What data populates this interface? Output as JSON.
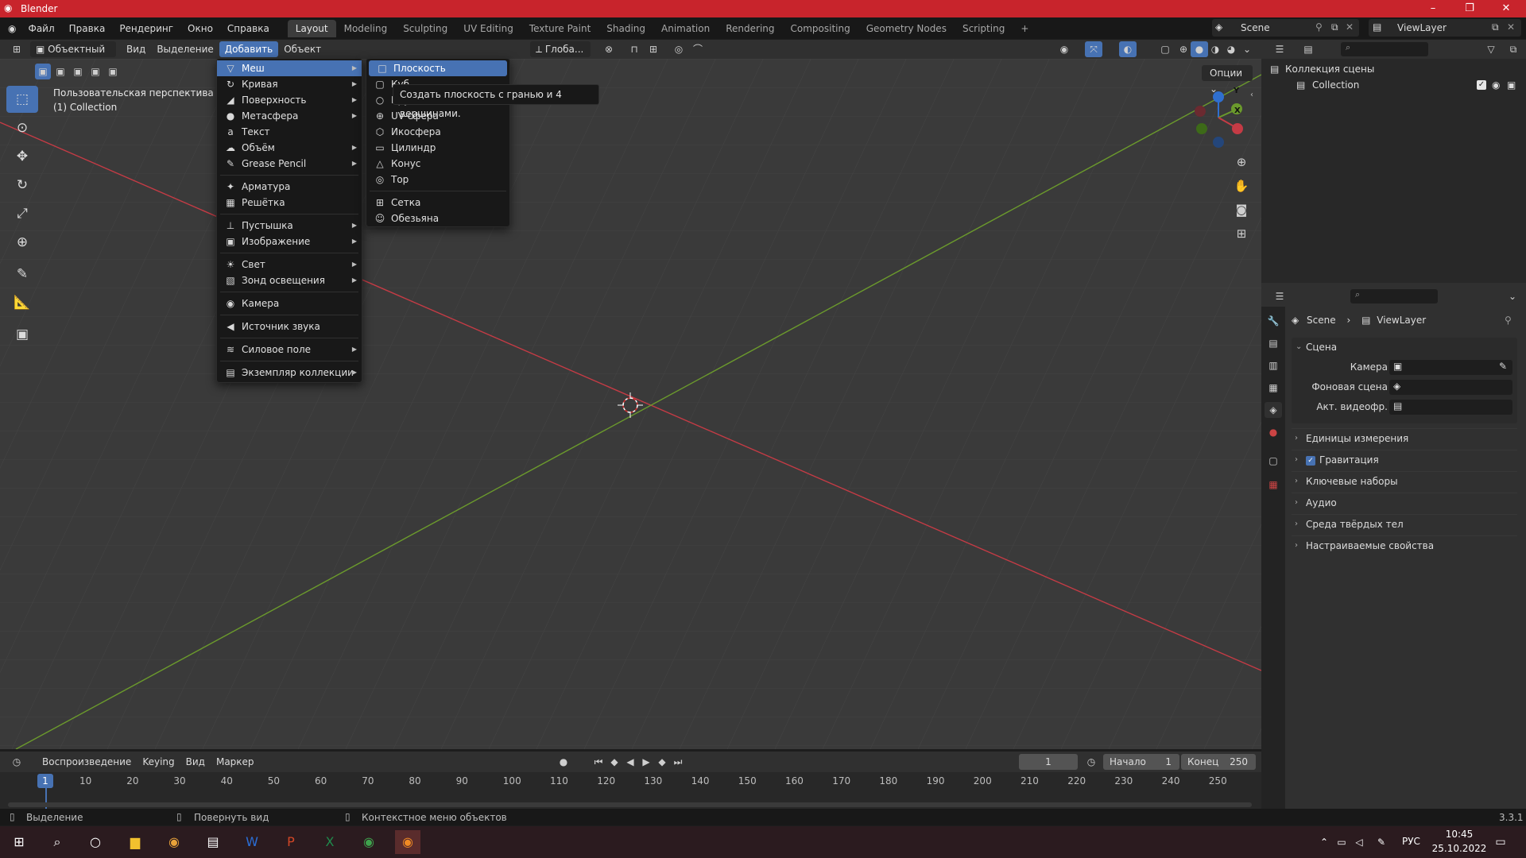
{
  "window": {
    "title": "Blender",
    "min": "–",
    "max": "❐",
    "close": "✕"
  },
  "topmenu": [
    "Файл",
    "Правка",
    "Рендеринг",
    "Окно",
    "Справка"
  ],
  "workspaces": [
    "Layout",
    "Modeling",
    "Sculpting",
    "UV Editing",
    "Texture Paint",
    "Shading",
    "Animation",
    "Rendering",
    "Compositing",
    "Geometry Nodes",
    "Scripting"
  ],
  "workspace_add": "+",
  "scene_field": "Scene",
  "viewlayer_field": "ViewLayer",
  "viewport_header": {
    "mode": "Объектный ...",
    "menus": [
      "Вид",
      "Выделение",
      "Добавить",
      "Объект"
    ],
    "active_menu": "Добавить",
    "transform": "Глоба...",
    "options": "Опции"
  },
  "viewport": {
    "view_name": "Пользовательская перспектива",
    "collection": "(1) Collection",
    "gizmo": {
      "z": "Z",
      "y": "Y",
      "x": "X"
    }
  },
  "add_menu": {
    "items": [
      {
        "label": "Меш",
        "icon": "mesh-icon",
        "glyph": "▽",
        "submenu": true
      },
      {
        "label": "Кривая",
        "icon": "curve-icon",
        "glyph": "↻",
        "submenu": true
      },
      {
        "label": "Поверхность",
        "icon": "surface-icon",
        "glyph": "◢",
        "submenu": true
      },
      {
        "label": "Метасфера",
        "icon": "metaball-icon",
        "glyph": "●",
        "submenu": true
      },
      {
        "label": "Текст",
        "icon": "text-icon",
        "glyph": "a",
        "submenu": false
      },
      {
        "label": "Объём",
        "icon": "volume-icon",
        "glyph": "☁",
        "submenu": true
      },
      {
        "label": "Grease Pencil",
        "icon": "grease-pencil-icon",
        "glyph": "✎",
        "submenu": true
      },
      {
        "label": "Арматура",
        "icon": "armature-icon",
        "glyph": "✦",
        "submenu": false
      },
      {
        "label": "Решётка",
        "icon": "lattice-icon",
        "glyph": "▦",
        "submenu": false
      },
      {
        "label": "Пустышка",
        "icon": "empty-icon",
        "glyph": "⊥",
        "submenu": true
      },
      {
        "label": "Изображение",
        "icon": "image-icon",
        "glyph": "▣",
        "submenu": true
      },
      {
        "label": "Свет",
        "icon": "light-icon",
        "glyph": "☀",
        "submenu": true
      },
      {
        "label": "Зонд освещения",
        "icon": "light-probe-icon",
        "glyph": "▧",
        "submenu": true
      },
      {
        "label": "Камера",
        "icon": "camera-icon",
        "glyph": "◉",
        "submenu": false
      },
      {
        "label": "Источник звука",
        "icon": "speaker-icon",
        "glyph": "◀",
        "submenu": false
      },
      {
        "label": "Силовое поле",
        "icon": "force-field-icon",
        "glyph": "≋",
        "submenu": true
      },
      {
        "label": "Экземпляр коллекции",
        "icon": "collection-instance-icon",
        "glyph": "▤",
        "submenu": true
      }
    ]
  },
  "mesh_menu": {
    "items": [
      {
        "label": "Плоскость",
        "icon": "plane-icon",
        "glyph": "□"
      },
      {
        "label": "Куб",
        "icon": "cube-icon",
        "glyph": "▢"
      },
      {
        "label": "Круг",
        "icon": "circle-icon",
        "glyph": "○"
      },
      {
        "label": "UV-сфера",
        "icon": "uv-sphere-icon",
        "glyph": "⊕"
      },
      {
        "label": "Икосфера",
        "icon": "ico-sphere-icon",
        "glyph": "⬡"
      },
      {
        "label": "Цилиндр",
        "icon": "cylinder-icon",
        "glyph": "▭"
      },
      {
        "label": "Конус",
        "icon": "cone-icon",
        "glyph": "△"
      },
      {
        "label": "Тор",
        "icon": "torus-icon",
        "glyph": "◎"
      },
      {
        "label": "Сетка",
        "icon": "grid-icon",
        "glyph": "⊞"
      },
      {
        "label": "Обезьяна",
        "icon": "monkey-icon",
        "glyph": "☺"
      }
    ],
    "tooltip": "Создать плоскость с гранью и 4 вершинами."
  },
  "outliner": {
    "root": "Коллекция сцены",
    "collection": "Collection"
  },
  "properties": {
    "breadcrumb_scene": "Scene",
    "breadcrumb_layer": "ViewLayer",
    "panel": "Сцена",
    "fields": [
      {
        "label": "Камера"
      },
      {
        "label": "Фоновая сцена"
      },
      {
        "label": "Акт. видеофр."
      }
    ],
    "sections": [
      "Единицы измерения",
      "Гравитация",
      "Ключевые наборы",
      "Аудио",
      "Среда твёрдых тел",
      "Настраиваемые свойства"
    ]
  },
  "timeline": {
    "menus": [
      "Воспроизведение",
      "Keying",
      "Вид",
      "Маркер"
    ],
    "current_frame": "1",
    "start_label": "Начало",
    "start": "1",
    "end_label": "Конец",
    "end": "250",
    "ticks": [
      "10",
      "20",
      "30",
      "40",
      "50",
      "60",
      "70",
      "80",
      "90",
      "100",
      "110",
      "120",
      "130",
      "140",
      "150",
      "160",
      "170",
      "180",
      "190",
      "200",
      "210",
      "220",
      "230",
      "240",
      "250"
    ],
    "playhead": "1"
  },
  "statusbar": {
    "select": "Выделение",
    "rotate": "Повернуть вид",
    "context": "Контекстное меню объектов",
    "version": "3.3.1"
  },
  "taskbar": {
    "lang": "РУС",
    "time": "10:45",
    "date": "25.10.2022"
  },
  "colors": {
    "accent": "#4772b3",
    "title": "#c8242c",
    "x_axis": "#c43b45",
    "y_axis": "#6b9a2c"
  }
}
